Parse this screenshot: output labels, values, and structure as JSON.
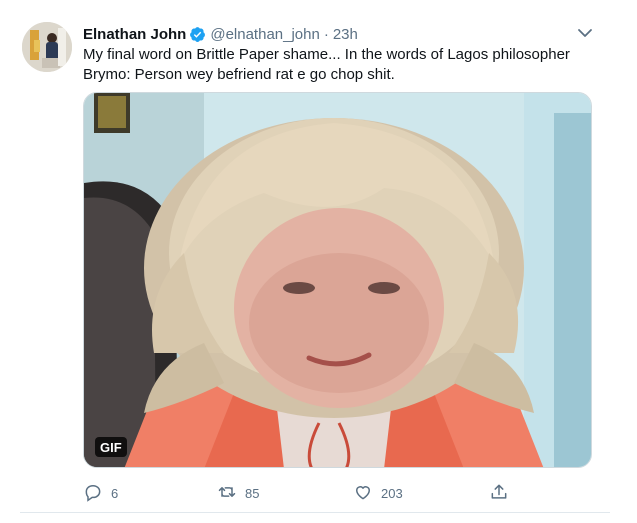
{
  "tweet": {
    "author_name": "Elnathan John",
    "handle": "@elnathan_john",
    "separator": "·",
    "timestamp": "23h",
    "text": "My final word on Brittle Paper shame... In the words of Lagos philosopher Brymo: Person wey befriend rat e go chop shit.",
    "media_badge": "GIF",
    "verified_icon": "verified-badge-icon",
    "accent_color": "#1da1f2"
  },
  "actions": {
    "reply_count": "6",
    "retweet_count": "85",
    "like_count": "203",
    "reply_icon": "reply-icon",
    "retweet_icon": "retweet-icon",
    "like_icon": "heart-icon",
    "share_icon": "share-icon"
  }
}
